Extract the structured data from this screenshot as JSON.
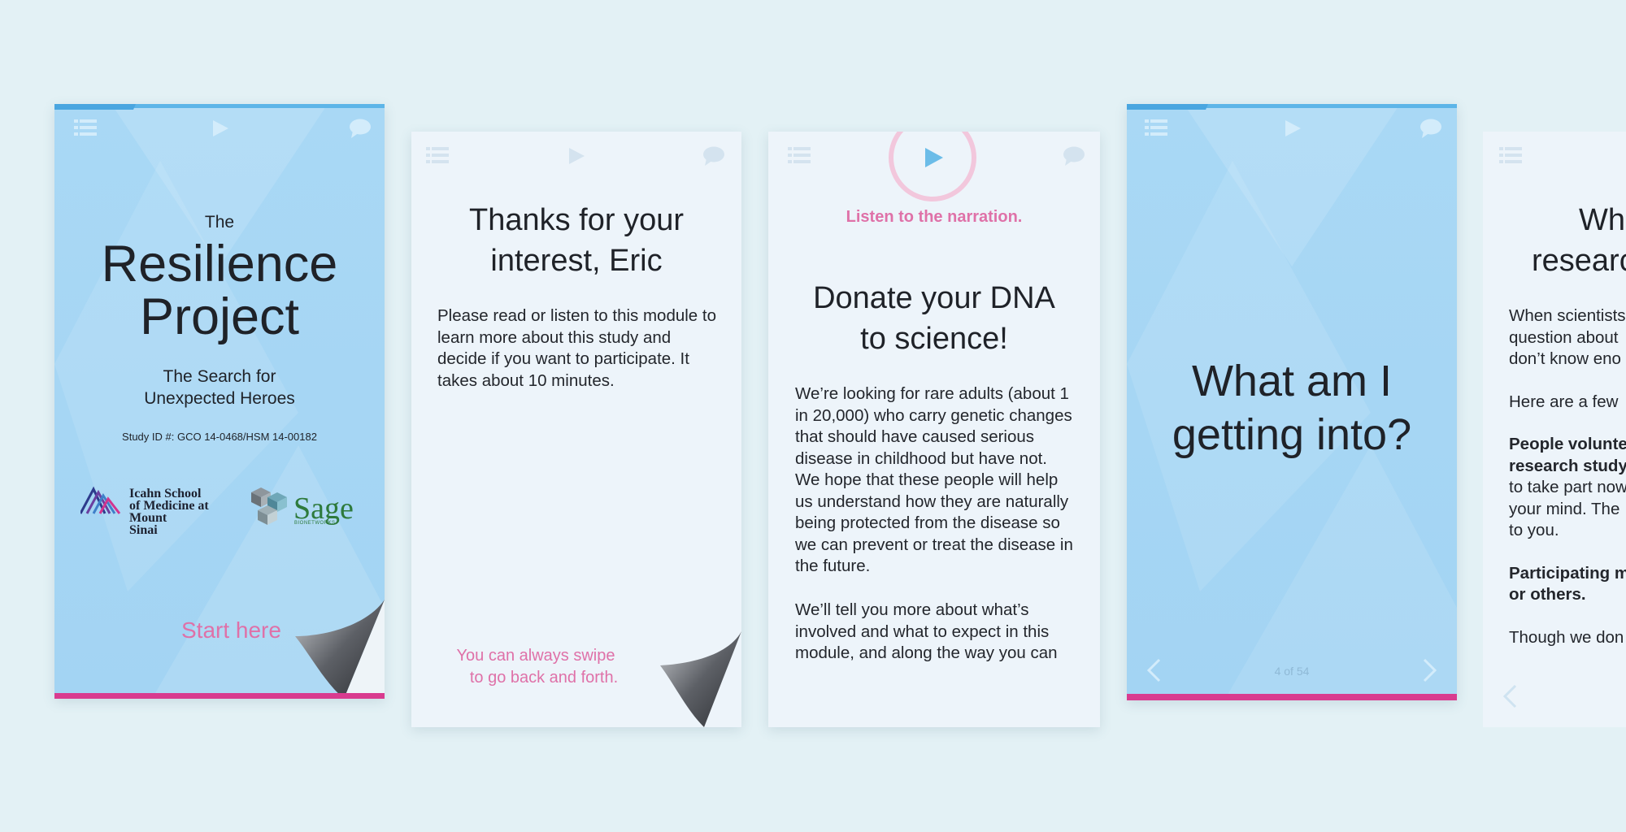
{
  "card1": {
    "the": "The",
    "title_line1": "Resilience",
    "title_line2": "Project",
    "subtitle_line1": "The Search for",
    "subtitle_line2": "Unexpected Heroes",
    "study_id": "Study ID #: GCO 14-0468/HSM 14-00182",
    "logo_sinai_line1": "Icahn School",
    "logo_sinai_line2": "of Medicine at",
    "logo_sinai_line3": "Mount",
    "logo_sinai_line4": "Sinai",
    "logo_sage": "Sage",
    "logo_sage_sub": "BIONETWORKS",
    "start_label": "Start here"
  },
  "card2": {
    "heading_line1": "Thanks for your",
    "heading_line2": "interest, Eric",
    "body": "Please read or listen to this module to learn more about this study and decide if you want to participate. It takes about 10 minutes.",
    "swipe_line1": "You can always swipe",
    "swipe_line2": "to go back and forth."
  },
  "card3": {
    "listen_label": "Listen to the narration.",
    "heading_line1": "Donate your DNA",
    "heading_line2": "to science!",
    "para1": "We’re looking for rare adults (about 1 in 20,000) who carry genetic changes that should have caused serious disease in childhood but have not. We hope that these people will help us understand how they are naturally being protected from the disease so we can prevent or treat the disease in the future.",
    "para2": "We’ll tell you more about what’s involved and what to expect in this module, and along the way you can"
  },
  "card4": {
    "heading_line1": "What am I",
    "heading_line2": "getting into?",
    "page_indicator": "4 of 54"
  },
  "card5": {
    "heading_line1": "Wh",
    "heading_line2": "researc",
    "para1_line1": "When scientists",
    "para1_line2": "question about",
    "para1_line3": "don’t know eno",
    "para2": "Here are a few",
    "bold1_line1": "People volunte",
    "bold1_line2": "research study",
    "para3_line1": "to take part now",
    "para3_line2": "your mind. The",
    "para3_line3": "to you.",
    "bold2_line1": "Participating m",
    "bold2_line2": "or others.",
    "para4": "Though we don"
  },
  "colors": {
    "accent_pink": "#df71a8",
    "bar_magenta": "#d93b8f",
    "sky_blue": "#a9d8f5",
    "top_bar_blue": "#5db5e8"
  },
  "icons": [
    "menu-icon",
    "play-icon",
    "chat-bubble-icon",
    "page-curl-icon",
    "chevron-left-icon",
    "chevron-right-icon"
  ]
}
